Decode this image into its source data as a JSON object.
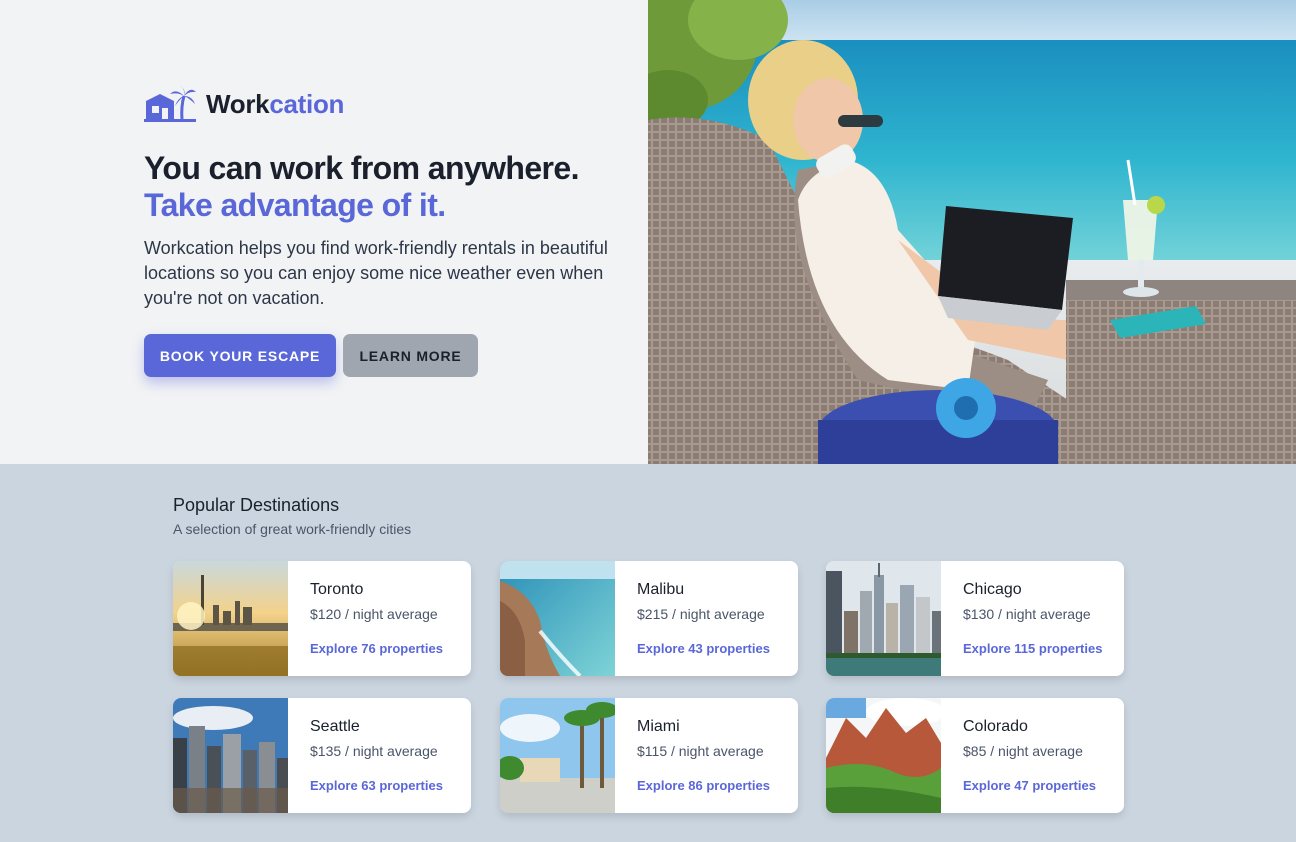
{
  "brand": {
    "name_part1": "Work",
    "name_part2": "cation"
  },
  "hero": {
    "headline_line1": "You can work from anywhere.",
    "headline_line2": "Take advantage of it.",
    "description": "Workcation helps you find work-friendly rentals in beautiful locations so you can enjoy some nice weather even when you're not on vacation.",
    "primary_button": "BOOK YOUR ESCAPE",
    "secondary_button": "LEARN MORE"
  },
  "popular": {
    "title": "Popular Destinations",
    "subtitle": "A selection of great work-friendly cities",
    "cities": [
      {
        "name": "Toronto",
        "price": "$120 / night average",
        "link": "Explore 76 properties"
      },
      {
        "name": "Malibu",
        "price": "$215 / night average",
        "link": "Explore 43 properties"
      },
      {
        "name": "Chicago",
        "price": "$130 / night average",
        "link": "Explore 115 properties"
      },
      {
        "name": "Seattle",
        "price": "$135 / night average",
        "link": "Explore 63 properties"
      },
      {
        "name": "Miami",
        "price": "$115 / night average",
        "link": "Explore 86 properties"
      },
      {
        "name": "Colorado",
        "price": "$85 / night average",
        "link": "Explore 47 properties"
      }
    ]
  },
  "colors": {
    "brand": "#5a67d8",
    "text": "#1a202c",
    "hero_bg": "#f2f3f5",
    "section_bg": "#cbd5e0"
  }
}
